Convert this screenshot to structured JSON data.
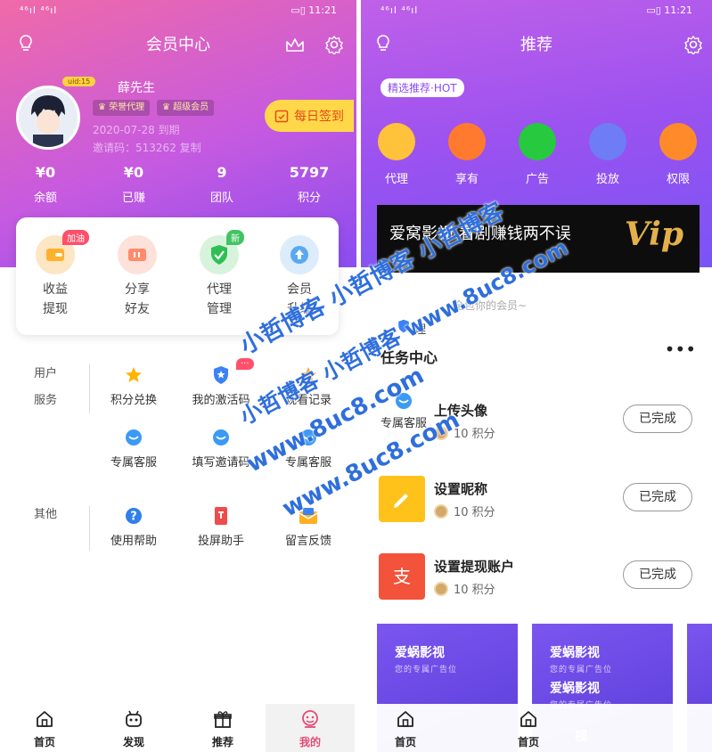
{
  "status_bar": {
    "signal": "⁴⁶ıl ⁴⁶ıl",
    "time": "11:21"
  },
  "left": {
    "title": "会员中心",
    "user": {
      "uid_tag": "uid:15",
      "name": "薛先生",
      "tag1": "荣誉代理",
      "tag2": "超级会员",
      "expire": "2020-07-28 到期",
      "invite_label": "邀请码：",
      "invite_code": "513262",
      "copy": "复制"
    },
    "sign_button": "每日签到",
    "stats": [
      {
        "value": "¥0",
        "label": "余额"
      },
      {
        "value": "¥0",
        "label": "已赚"
      },
      {
        "value": "9",
        "label": "团队"
      },
      {
        "value": "5797",
        "label": "积分"
      }
    ],
    "quick": [
      {
        "label": "收益\n提现",
        "badge": "加油"
      },
      {
        "label": "分享\n好友",
        "badge": ""
      },
      {
        "label": "代理\n管理",
        "badge": "新"
      },
      {
        "label": "会员\n升级",
        "badge": ""
      }
    ],
    "user_service": {
      "title1": "用户",
      "title2": "服务",
      "items": [
        "积分兑换",
        "我的激活码",
        "观看记录",
        "专属客服",
        "填写邀请码",
        "专属客服"
      ]
    },
    "other": {
      "title": "其他",
      "items": [
        "使用帮助",
        "投屏助手",
        "留言反馈"
      ]
    },
    "tabs": [
      "首页",
      "发现",
      "推荐",
      "我的"
    ]
  },
  "right": {
    "title": "推荐",
    "pill": "精选推荐·HOT",
    "circles": [
      {
        "label": "代理",
        "color": "#ffb23a"
      },
      {
        "label": "享有",
        "color": "#ff7a2e"
      },
      {
        "label": "广告",
        "color": "#27c93f"
      },
      {
        "label": "投放",
        "color": "#6e7cf5"
      },
      {
        "label": "权限",
        "color": "#ff8a2a"
      }
    ],
    "banner_text": "爱窝影视  看剧赚钱两不误",
    "banner_vip": "Vip",
    "subtitle": "全包你的会员~",
    "floating_label": "理",
    "task_center": "任务中心",
    "more": "•••",
    "floating_service": "专属客服",
    "tasks": [
      {
        "name": "上传头像",
        "points": "10 积分",
        "button": "已完成"
      },
      {
        "name": "设置昵称",
        "points": "10 积分",
        "button": "已完成"
      },
      {
        "name": "设置提现账户",
        "points": "10 积分",
        "button": "已完成"
      }
    ],
    "ads": [
      {
        "title": "爱蜗影视",
        "sub": "您的专属广告位"
      },
      {
        "title": "爱蜗影视",
        "sub": "您的专属广告位"
      },
      {
        "title": "爱蜗影视",
        "sub": ""
      }
    ],
    "ad_extra_title": "爱蜗影视",
    "ad_extra_title2": "视",
    "tabs": [
      "首页",
      "首页"
    ]
  },
  "watermark": {
    "line1": "小哲博客 小哲博客 小哲博客",
    "line2": "小哲博客 小哲博客 www.8uc8.com",
    "line3": "www.8uc8.com",
    "line4": "www.8uc8.com"
  }
}
